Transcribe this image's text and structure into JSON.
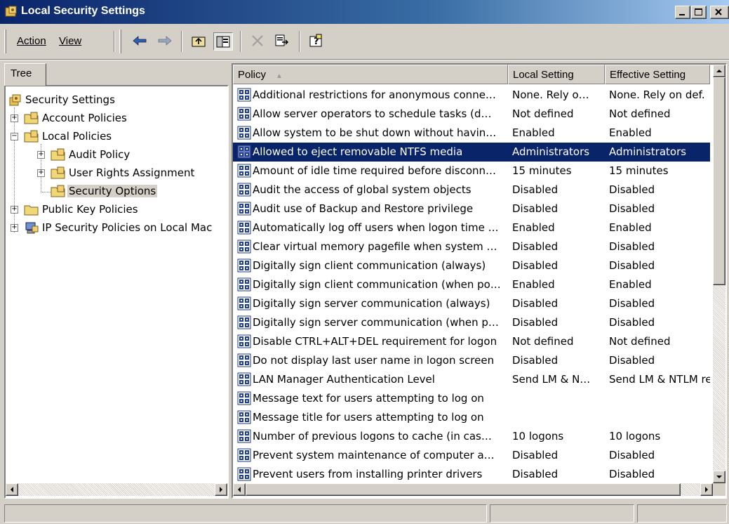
{
  "window": {
    "title": "Local Security Settings"
  },
  "menu": {
    "action_label": "Action",
    "view_label": "View"
  },
  "tree": {
    "tab_label": "Tree",
    "items": [
      {
        "label": "Security Settings"
      },
      {
        "label": "Account Policies"
      },
      {
        "label": "Local Policies"
      },
      {
        "label": "Audit Policy"
      },
      {
        "label": "User Rights Assignment"
      },
      {
        "label": "Security Options"
      },
      {
        "label": "Public Key Policies"
      },
      {
        "label": "IP Security Policies on Local Mac"
      }
    ]
  },
  "list": {
    "columns": [
      "Policy",
      "Local Setting",
      "Effective Setting"
    ],
    "rows": [
      {
        "policy": "Additional restrictions for anonymous conne…",
        "local": "None. Rely o…",
        "effective": "None. Rely on def."
      },
      {
        "policy": "Allow server operators to schedule tasks (d…",
        "local": "Not defined",
        "effective": "Not defined"
      },
      {
        "policy": "Allow system to be shut down without havin…",
        "local": "Enabled",
        "effective": "Enabled"
      },
      {
        "policy": "Allowed to eject removable NTFS media",
        "local": "Administrators",
        "effective": "Administrators"
      },
      {
        "policy": "Amount of idle time required before disconn…",
        "local": "15 minutes",
        "effective": "15 minutes"
      },
      {
        "policy": "Audit the access of global system objects",
        "local": "Disabled",
        "effective": "Disabled"
      },
      {
        "policy": "Audit use of Backup and Restore privilege",
        "local": "Disabled",
        "effective": "Disabled"
      },
      {
        "policy": "Automatically log off users when logon time …",
        "local": "Enabled",
        "effective": "Enabled"
      },
      {
        "policy": "Clear virtual memory pagefile when system …",
        "local": "Disabled",
        "effective": "Disabled"
      },
      {
        "policy": "Digitally sign client communication (always)",
        "local": "Disabled",
        "effective": "Disabled"
      },
      {
        "policy": "Digitally sign client communication (when po…",
        "local": "Enabled",
        "effective": "Enabled"
      },
      {
        "policy": "Digitally sign server communication (always)",
        "local": "Disabled",
        "effective": "Disabled"
      },
      {
        "policy": "Digitally sign server communication (when p…",
        "local": "Disabled",
        "effective": "Disabled"
      },
      {
        "policy": "Disable CTRL+ALT+DEL requirement for logon",
        "local": "Not defined",
        "effective": "Not defined"
      },
      {
        "policy": "Do not display last user name in logon screen",
        "local": "Disabled",
        "effective": "Disabled"
      },
      {
        "policy": "LAN Manager Authentication Level",
        "local": "Send LM & N…",
        "effective": "Send LM & NTLM re"
      },
      {
        "policy": "Message text for users attempting to log on",
        "local": "",
        "effective": ""
      },
      {
        "policy": "Message title for users attempting to log on",
        "local": "",
        "effective": ""
      },
      {
        "policy": "Number of previous logons to cache (in cas…",
        "local": "10 logons",
        "effective": "10 logons"
      },
      {
        "policy": "Prevent system maintenance of computer a…",
        "local": "Disabled",
        "effective": "Disabled"
      },
      {
        "policy": "Prevent users from installing printer drivers",
        "local": "Disabled",
        "effective": "Disabled"
      }
    ],
    "selected_index": 3
  },
  "colors": {
    "title_bar": "#0a246a",
    "selection": "#0a246a",
    "face": "#d4d0c8"
  },
  "icons": {
    "policy_row": "policy-shield-icon",
    "tree_folder": "folder-icon",
    "tree_root": "security-settings-icon"
  }
}
